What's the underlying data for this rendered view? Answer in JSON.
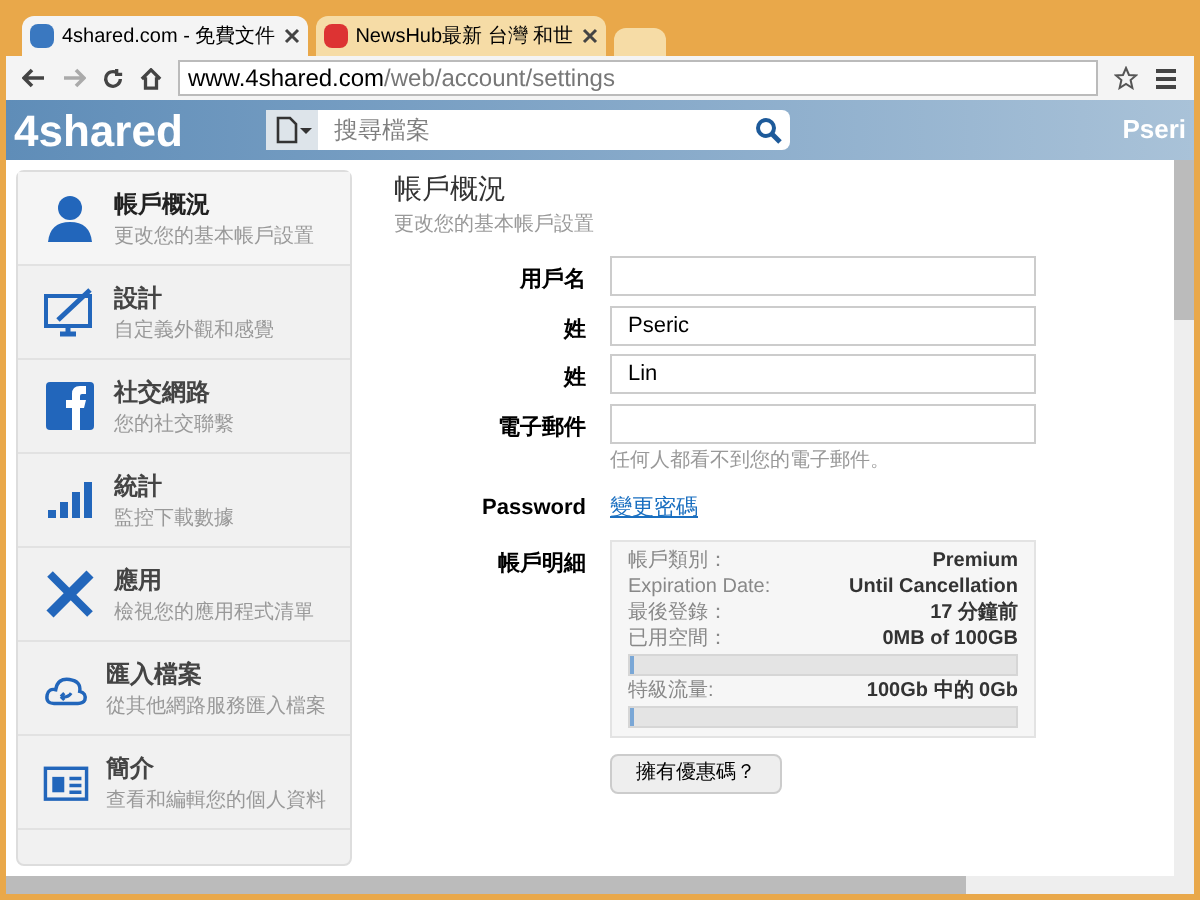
{
  "browser": {
    "tabs": [
      {
        "title": "4shared.com - 免費文件",
        "selected": true
      },
      {
        "title": "NewsHub最新 台灣 和世",
        "selected": false
      }
    ],
    "address": {
      "host": "www.4shared.com",
      "path": "/web/account/settings"
    }
  },
  "site_header": {
    "logo": "4shared",
    "search": {
      "placeholder": "搜尋檔案"
    },
    "user": "Pseri"
  },
  "sidebar": {
    "items": [
      {
        "kind": "person",
        "title": "帳戶概況",
        "subtitle": "更改您的基本帳戶設置",
        "selected": true
      },
      {
        "kind": "design",
        "title": "設計",
        "subtitle": "自定義外觀和感覺",
        "selected": false
      },
      {
        "kind": "social",
        "title": "社交網路",
        "subtitle": "您的社交聯繫",
        "selected": false
      },
      {
        "kind": "stats",
        "title": "統計",
        "subtitle": "監控下載數據",
        "selected": false
      },
      {
        "kind": "apps",
        "title": "應用",
        "subtitle": "檢視您的應用程式清單",
        "selected": false
      },
      {
        "kind": "import",
        "title": "匯入檔案",
        "subtitle": "從其他網路服務匯入檔案",
        "selected": false
      },
      {
        "kind": "profile",
        "title": "簡介",
        "subtitle": "查看和編輯您的個人資料",
        "selected": false
      }
    ]
  },
  "main": {
    "title": "帳戶概況",
    "subtitle": "更改您的基本帳戶設置",
    "fields": [
      {
        "label": "用戶名"
      },
      {
        "label": "姓",
        "value": "Pseric"
      },
      {
        "label": "姓",
        "value": "Lin"
      },
      {
        "label": "電子郵件",
        "hint": "任何人都看不到您的電子郵件。"
      }
    ],
    "password": {
      "label": "Password",
      "link": "變更密碼"
    },
    "details": {
      "label": "帳戶明細",
      "rows": [
        {
          "kind": "text",
          "name": "帳戶類別：",
          "value": "Premium"
        },
        {
          "kind": "text",
          "name": "Expiration Date:",
          "value": "Until Cancellation"
        },
        {
          "kind": "text",
          "name": "最後登錄：",
          "value": "17 分鐘前"
        },
        {
          "kind": "meter",
          "name": "已用空間：",
          "value": "0MB of 100GB",
          "level": 0
        },
        {
          "kind": "meter",
          "name": "特級流量:",
          "value": "100Gb 中的 0Gb",
          "level": 0
        }
      ]
    },
    "coupon_button": "擁有優惠碼？"
  }
}
